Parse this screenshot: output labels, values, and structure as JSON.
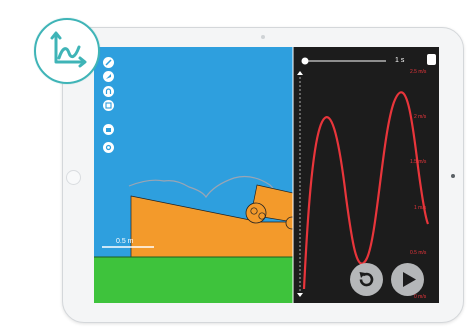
{
  "scale_bar": {
    "label": "0.5 m"
  },
  "timeline": {
    "time_label": "1 s"
  },
  "speed_graph": {
    "y_tick_labels": [
      "2.5 m/s",
      "2 m/s",
      "1.5 m/s",
      "1 m/s",
      "0.5 m/s",
      "0 m/s"
    ]
  },
  "icons": {
    "badge": "velocity-graph-icon",
    "tools": [
      "pen-icon",
      "eraser-icon",
      "magnet-icon",
      "stamp-icon",
      "folder-icon",
      "settings-icon"
    ],
    "replay": "replay-icon",
    "play": "play-icon"
  },
  "colors": {
    "sky": "#2e9fde",
    "ground": "#3ec33c",
    "ramp": "#f39a2b",
    "graph_bg": "#1c1c1c",
    "speed_curve": "#e8353b",
    "trajectory": "#9aa5b4",
    "accent": "#3fb4b7"
  }
}
